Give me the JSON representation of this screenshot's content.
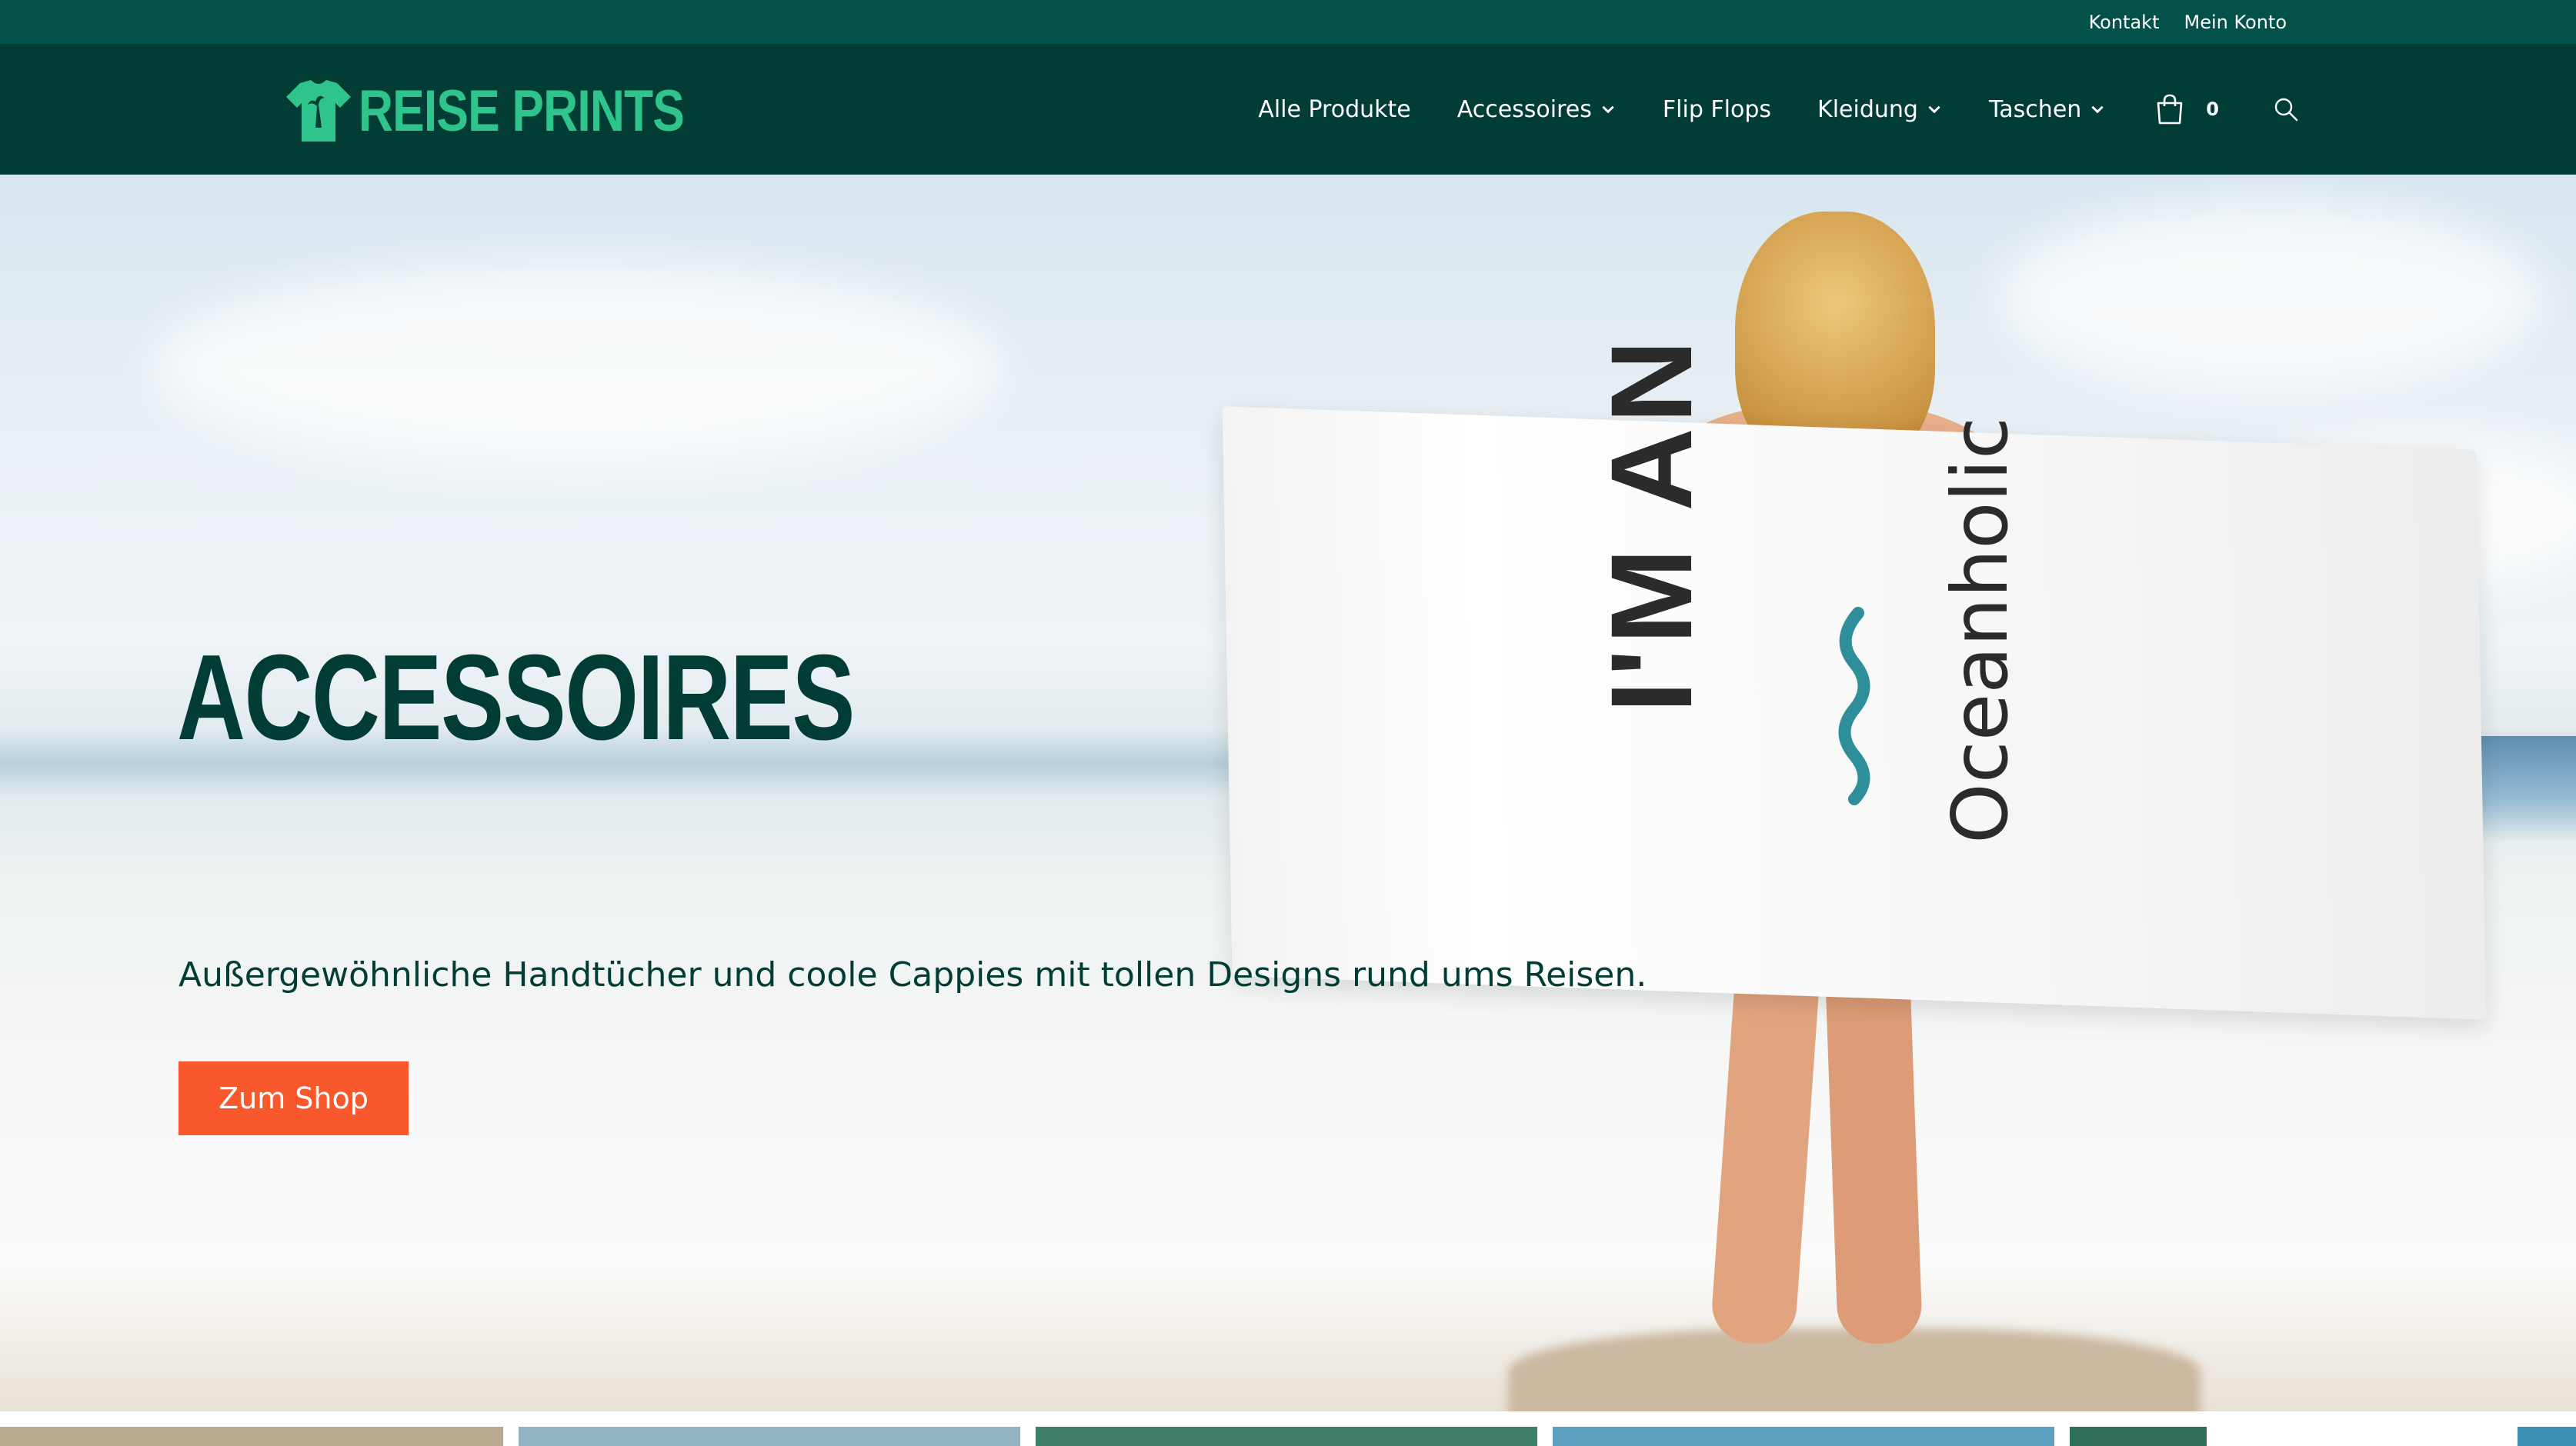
{
  "topbar": {
    "links": [
      "Kontakt",
      "Mein Konto"
    ]
  },
  "header": {
    "logo_text": "REISE PRINTS",
    "nav": [
      {
        "label": "Alle Produkte",
        "dropdown": false
      },
      {
        "label": "Accessoires",
        "dropdown": true
      },
      {
        "label": "Flip Flops",
        "dropdown": false
      },
      {
        "label": "Kleidung",
        "dropdown": true
      },
      {
        "label": "Taschen",
        "dropdown": true
      }
    ],
    "cart_count": "0",
    "icons": [
      "shopping-bag-icon",
      "search-icon"
    ]
  },
  "hero": {
    "title": "ACCESSOIRES",
    "subtitle": "Außergewöhnliche Handtücher und coole Cappies mit tollen Designs rund ums Reisen.",
    "button_label": "Zum Shop",
    "towel_text_1": "I'M AN",
    "towel_text_2": "Oceanholic"
  },
  "colors": {
    "topbar": "#03524a",
    "header": "#023d35",
    "logo": "#2fc48b",
    "accent_button": "#f9582c",
    "hero_text": "#023d35"
  }
}
